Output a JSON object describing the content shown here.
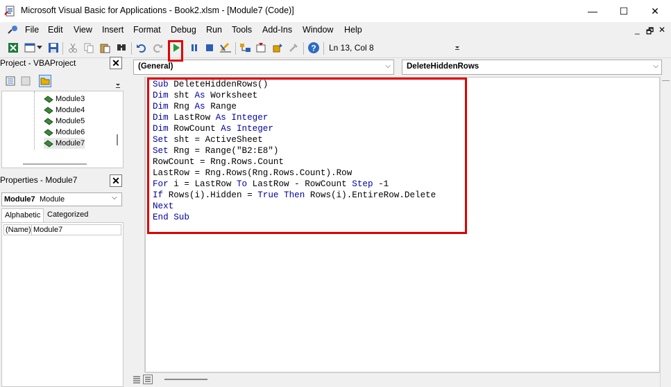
{
  "window": {
    "title": "Microsoft Visual Basic for Applications - Book2.xlsm - [Module7 (Code)]",
    "minimize": "—",
    "maximize": "☐",
    "close": "✕"
  },
  "menu": {
    "items": [
      "File",
      "Edit",
      "View",
      "Insert",
      "Format",
      "Debug",
      "Run",
      "Tools",
      "Add-Ins",
      "Window",
      "Help"
    ],
    "mdi_minimize": "_",
    "mdi_restore": "🗗",
    "mdi_close": "✕"
  },
  "toolbar": {
    "icons": [
      "excel-icon",
      "insert-userform-icon",
      "save-icon",
      "cut-icon",
      "copy-icon",
      "paste-icon",
      "find-icon",
      "undo-icon",
      "redo-icon",
      "run-icon",
      "break-icon",
      "reset-icon",
      "design-mode-icon",
      "project-explorer-icon",
      "properties-icon",
      "object-browser-icon",
      "toolbox-icon",
      "help-icon"
    ],
    "position": "Ln 13, Col 8"
  },
  "project": {
    "title": "Project - VBAProject",
    "close": "✕",
    "modules": [
      "Module3",
      "Module4",
      "Module5",
      "Module6",
      "Module7"
    ],
    "selected": "Module7"
  },
  "properties": {
    "title": "Properties - Module7",
    "close": "✕",
    "object_name": "Module7",
    "object_type": "Module",
    "tabs": [
      "Alphabetic",
      "Categorized"
    ],
    "active_tab": "Alphabetic",
    "rows": [
      {
        "name": "(Name)",
        "value": "Module7"
      }
    ]
  },
  "code": {
    "object_combo": "(General)",
    "proc_combo": "DeleteHiddenRows",
    "lines": [
      "Sub DeleteHiddenRows()",
      "Dim sht As Worksheet",
      "Dim Rng As Range",
      "Dim LastRow As Integer",
      "Dim RowCount As Integer",
      "Set sht = ActiveSheet",
      "Set Rng = Range(\"B2:E8\")",
      "RowCount = Rng.Rows.Count",
      "LastRow = Rng.Rows(Rng.Rows.Count).Row",
      "For i = LastRow To LastRow - RowCount Step -1",
      "If Rows(i).Hidden = True Then Rows(i).EntireRow.Delete",
      "Next",
      "End Sub"
    ],
    "keywords": [
      "Sub",
      "Dim",
      "As",
      "Integer",
      "Set",
      "For",
      "To",
      "Step",
      "If",
      "Then",
      "Next",
      "End",
      "True"
    ]
  }
}
